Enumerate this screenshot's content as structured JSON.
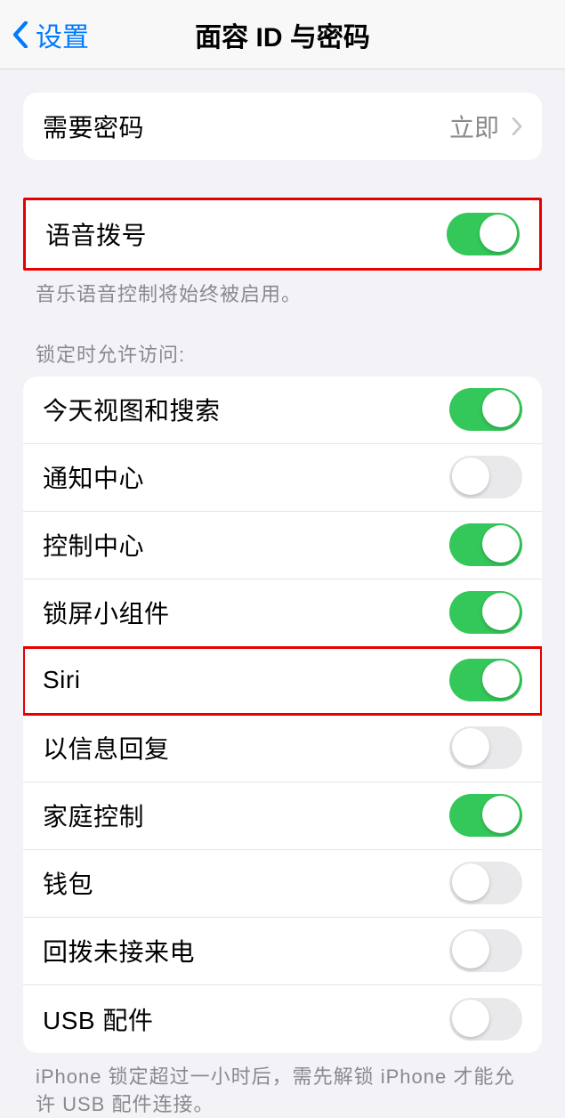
{
  "header": {
    "back_label": "设置",
    "title": "面容 ID 与密码"
  },
  "require_passcode": {
    "label": "需要密码",
    "value": "立即"
  },
  "voice_dial": {
    "label": "语音拨号",
    "on": true,
    "footer": "音乐语音控制将始终被启用。"
  },
  "locked_section_header": "锁定时允许访问:",
  "locked_items": [
    {
      "label": "今天视图和搜索",
      "on": true
    },
    {
      "label": "通知中心",
      "on": false
    },
    {
      "label": "控制中心",
      "on": true
    },
    {
      "label": "锁屏小组件",
      "on": true
    },
    {
      "label": "Siri",
      "on": true
    },
    {
      "label": "以信息回复",
      "on": false
    },
    {
      "label": "家庭控制",
      "on": true
    },
    {
      "label": "钱包",
      "on": false
    },
    {
      "label": "回拨未接来电",
      "on": false
    },
    {
      "label": "USB 配件",
      "on": false
    }
  ],
  "locked_footer": "iPhone 锁定超过一小时后，需先解锁 iPhone 才能允许 USB 配件连接。",
  "highlighted_rows": [
    0,
    4
  ]
}
